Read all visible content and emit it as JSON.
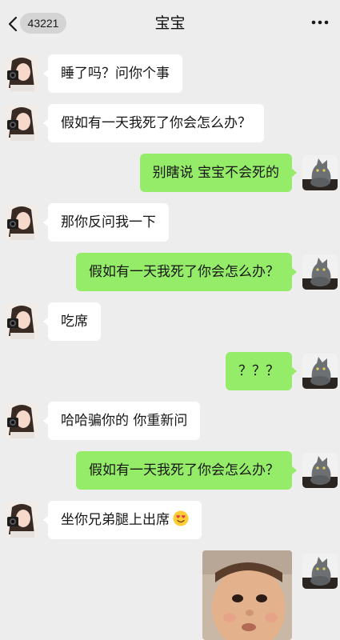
{
  "header": {
    "unread_count": "43221",
    "title": "宝宝"
  },
  "messages": [
    {
      "side": "left",
      "text": "睡了吗？问你个事"
    },
    {
      "side": "left",
      "text": "假如有一天我死了你会怎么办？"
    },
    {
      "side": "right",
      "text": "别瞎说 宝宝不会死的"
    },
    {
      "side": "left",
      "text": "那你反问我一下"
    },
    {
      "side": "right",
      "text": "假如有一天我死了你会怎么办？"
    },
    {
      "side": "left",
      "text": "吃席"
    },
    {
      "side": "right",
      "text": "？？？"
    },
    {
      "side": "left",
      "text": "哈哈骗你的 你重新问"
    },
    {
      "side": "right",
      "text": "假如有一天我死了你会怎么办？"
    },
    {
      "side": "left",
      "text": "坐你兄弟腿上出席",
      "emoji": "smiling-heart-eyes-emoji"
    }
  ],
  "colors": {
    "background": "#ededed",
    "sent_bubble": "#95ec69",
    "received_bubble": "#ffffff"
  },
  "icons": {
    "back": "chevron-left-icon",
    "more": "ellipsis-icon"
  }
}
